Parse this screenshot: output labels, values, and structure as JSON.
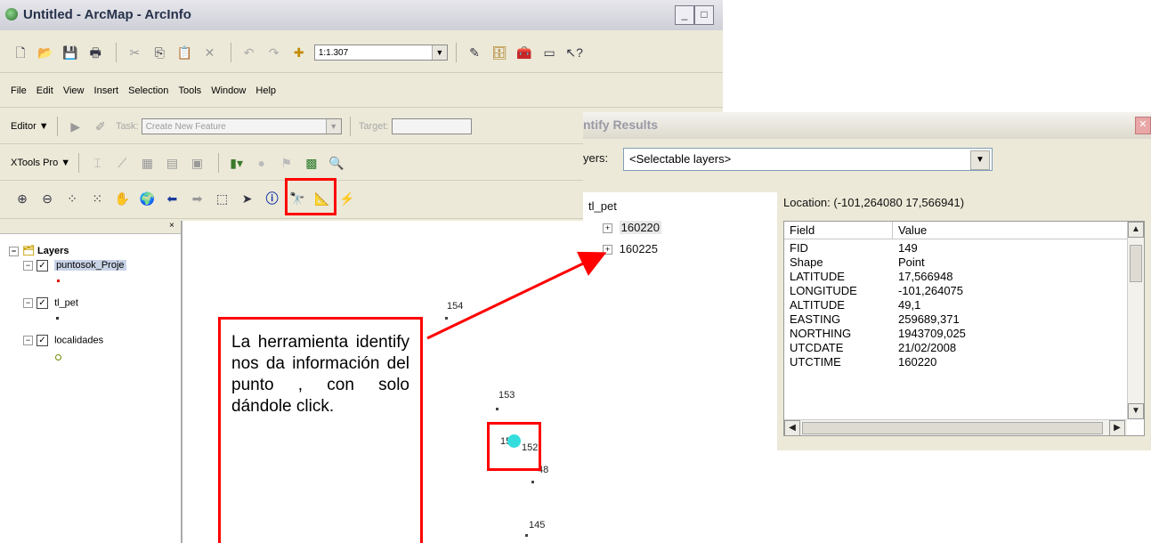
{
  "arcmap": {
    "title": "Untitled - ArcMap - ArcInfo",
    "window_buttons": [
      "_",
      "□"
    ],
    "scale_value": "1:1.307",
    "menu": [
      "File",
      "Edit",
      "View",
      "Insert",
      "Selection",
      "Tools",
      "Window",
      "Help"
    ],
    "editor_label": "Editor ▼",
    "task_label": "Task:",
    "task_value": "Create New Feature",
    "target_label": "Target:",
    "xtools_label": "XTools Pro ▼",
    "toc": {
      "root": "Layers",
      "layers": [
        "puntosok_Proje",
        "tl_pet",
        "localidades"
      ]
    },
    "map_labels": [
      "154",
      "153",
      "15",
      "152",
      "48",
      "145"
    ]
  },
  "identify": {
    "title": "ntify Results",
    "layers_label": "yers:",
    "layers_value": "<Selectable layers>",
    "tree_root": "tl_pet",
    "tree_items": [
      "160220",
      "160225"
    ],
    "location": "Location: (-101,264080 17,566941)",
    "columns": [
      "Field",
      "Value"
    ],
    "rows": [
      {
        "field": "FID",
        "value": "149"
      },
      {
        "field": "Shape",
        "value": "Point"
      },
      {
        "field": "LATITUDE",
        "value": "17,566948"
      },
      {
        "field": "LONGITUDE",
        "value": "-101,264075"
      },
      {
        "field": "ALTITUDE",
        "value": "49,1"
      },
      {
        "field": "EASTING",
        "value": "259689,371"
      },
      {
        "field": "NORTHING",
        "value": "1943709,025"
      },
      {
        "field": "UTCDATE",
        "value": "21/02/2008"
      },
      {
        "field": "UTCTIME",
        "value": "160220"
      }
    ]
  },
  "annotation": {
    "text": "La herramienta identify nos da información del punto , con solo dándole click."
  },
  "colors": {
    "highlight": "#ff0000",
    "selected_point": "#33dddd"
  }
}
